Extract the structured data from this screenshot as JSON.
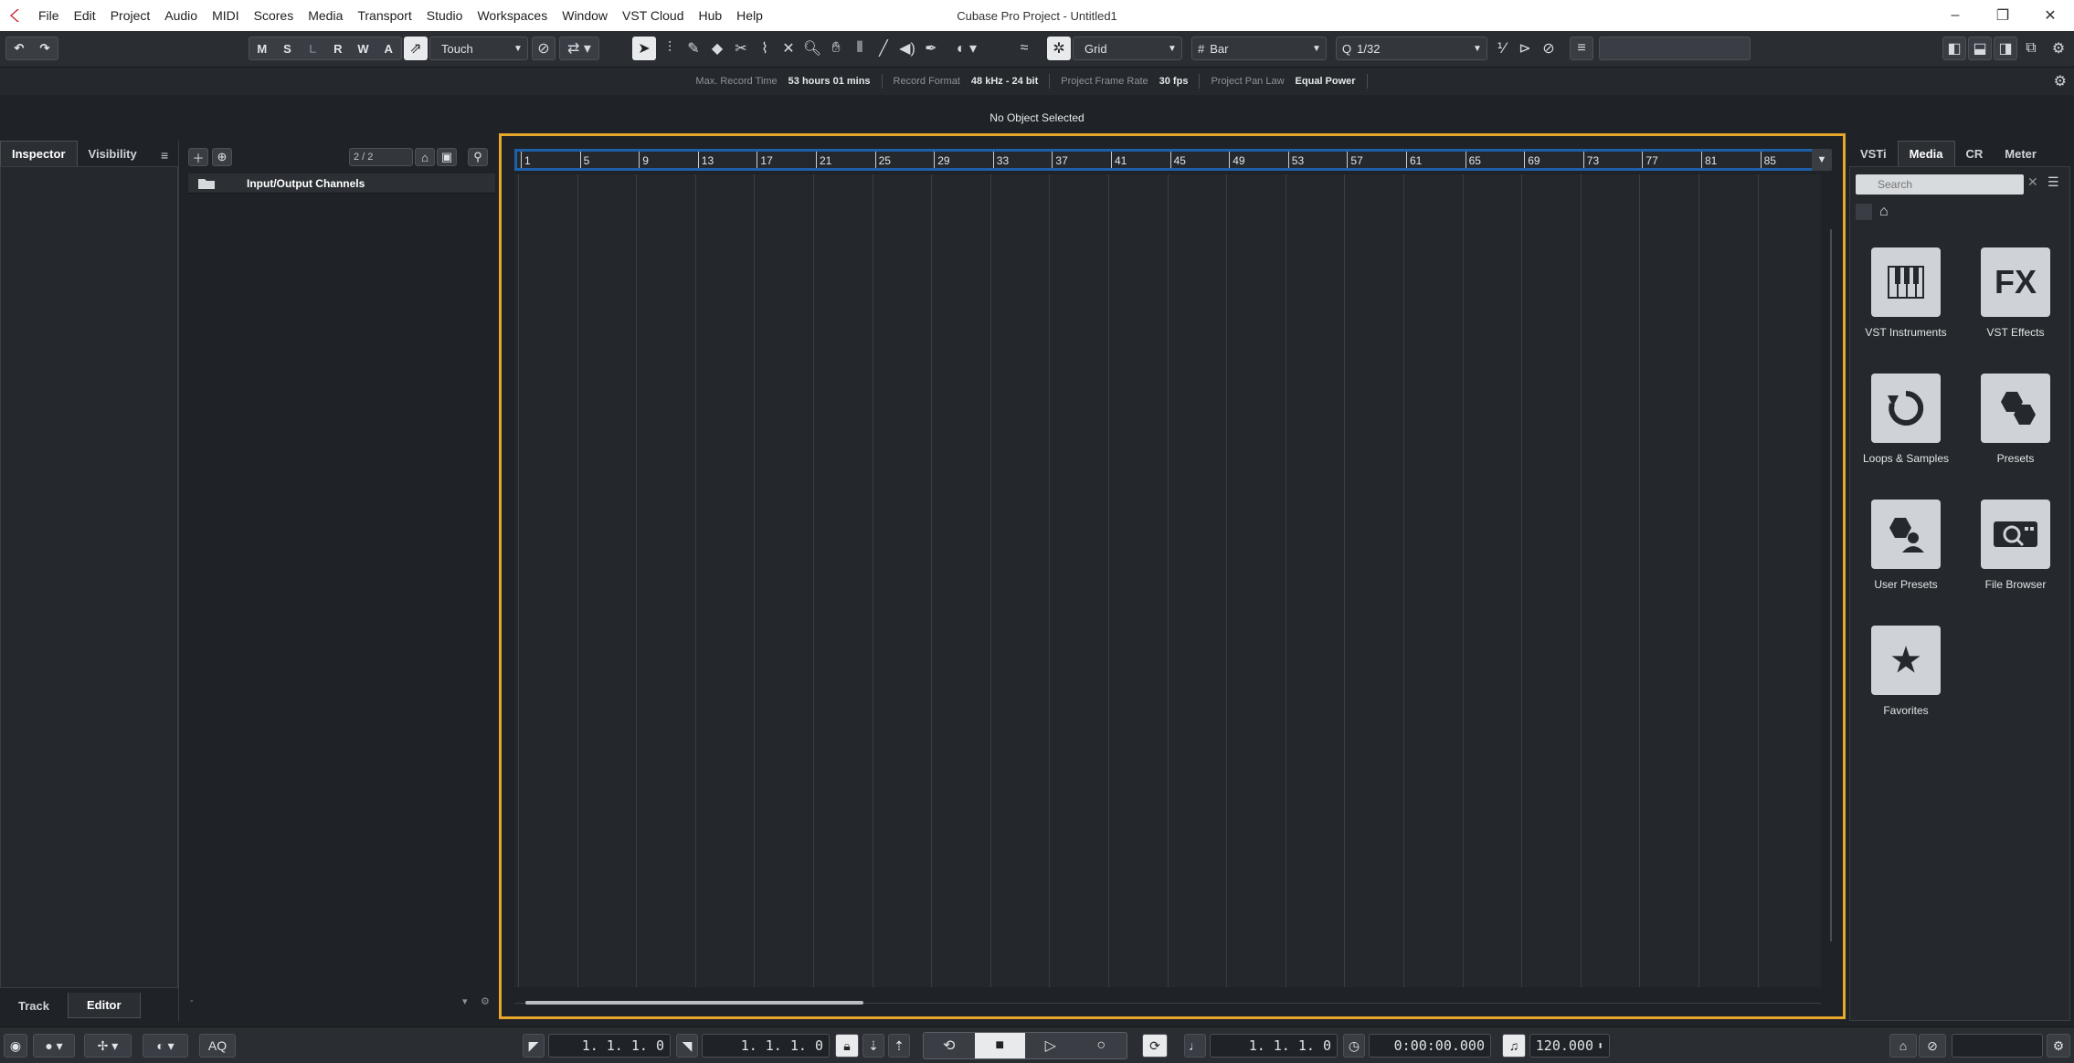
{
  "menubar": {
    "items": [
      "File",
      "Edit",
      "Project",
      "Audio",
      "MIDI",
      "Scores",
      "Media",
      "Transport",
      "Studio",
      "Workspaces",
      "Window",
      "VST Cloud",
      "Hub",
      "Help"
    ],
    "window_title": "Cubase Pro Project - Untitled1"
  },
  "toolbar": {
    "mode_buttons": [
      "M",
      "S",
      "L",
      "R",
      "W",
      "A"
    ],
    "automation_mode": "Touch",
    "snap_type": "Grid",
    "grid_type": "Bar",
    "quantize_label": "Q",
    "quantize_value": "1/32"
  },
  "status": {
    "max_record_time_label": "Max. Record Time",
    "max_record_time_value": "53 hours 01 mins",
    "record_format_label": "Record Format",
    "record_format_value": "48 kHz - 24 bit",
    "frame_rate_label": "Project Frame Rate",
    "frame_rate_value": "30 fps",
    "pan_law_label": "Project Pan Law",
    "pan_law_value": "Equal Power"
  },
  "info_line": "No Object Selected",
  "left_zone": {
    "tabs": [
      "Inspector",
      "Visibility"
    ],
    "bottom_tabs": [
      "Track",
      "Editor"
    ]
  },
  "track_list": {
    "count": "2 / 2",
    "tracks": [
      {
        "name": "Input/Output Channels"
      }
    ]
  },
  "ruler": {
    "bars": [
      "1",
      "5",
      "9",
      "13",
      "17",
      "21",
      "25",
      "29",
      "33",
      "37",
      "41",
      "45",
      "49",
      "53",
      "57",
      "61",
      "65",
      "69",
      "73",
      "77",
      "81",
      "85"
    ]
  },
  "right_zone": {
    "tabs": [
      "VSTi",
      "Media",
      "CR",
      "Meter"
    ],
    "search_placeholder": "Search",
    "tiles": [
      {
        "label": "VST Instruments",
        "icon": "piano-keys-icon"
      },
      {
        "label": "VST Effects",
        "icon": "fx-icon"
      },
      {
        "label": "Loops & Samples",
        "icon": "loop-icon"
      },
      {
        "label": "Presets",
        "icon": "presets-icon"
      },
      {
        "label": "User Presets",
        "icon": "user-presets-icon"
      },
      {
        "label": "File Browser",
        "icon": "file-browser-icon"
      },
      {
        "label": "Favorites",
        "icon": "star-icon"
      }
    ]
  },
  "transport": {
    "aq_label": "AQ",
    "left_locator": "1. 1. 1.   0",
    "right_locator": "1. 1. 1.   0",
    "primary_time": "1. 1. 1.   0",
    "secondary_time": "0:00:00.000",
    "tempo": "120.000"
  },
  "colors": {
    "project_window_highlight": "#e6a72a",
    "ruler_highlight": "#1d5fa8"
  }
}
